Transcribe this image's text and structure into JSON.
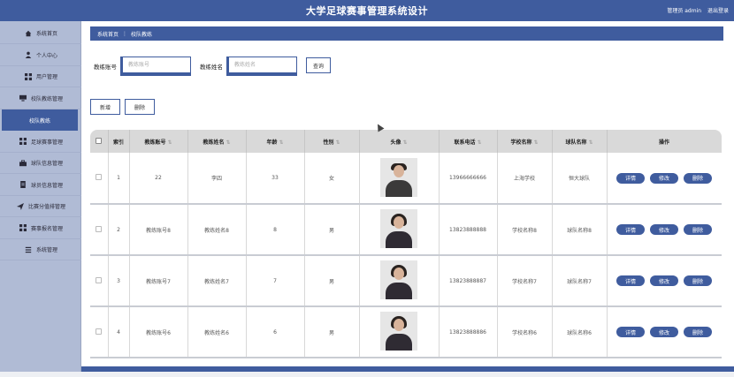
{
  "header": {
    "title": "大学足球赛事管理系统设计",
    "user_label": "管理员 admin",
    "logout_label": "退出登录"
  },
  "sidebar": {
    "items": [
      {
        "label": "系统首页",
        "icon": "home-icon"
      },
      {
        "label": "个人中心",
        "icon": "person-icon"
      },
      {
        "label": "用户管理",
        "icon": "grid-icon"
      },
      {
        "label": "校队教练管理",
        "icon": "screen-icon"
      },
      {
        "label": "校队教练",
        "icon": "",
        "active": true
      },
      {
        "label": "足球赛事管理",
        "icon": "grid-icon"
      },
      {
        "label": "球队信息管理",
        "icon": "briefcase-icon"
      },
      {
        "label": "球员信息管理",
        "icon": "document-icon"
      },
      {
        "label": "比赛分值排管理",
        "icon": "plane-icon"
      },
      {
        "label": "赛事报名管理",
        "icon": "grid-icon"
      },
      {
        "label": "系统管理",
        "icon": "settings-icon"
      }
    ]
  },
  "breadcrumb": {
    "home": "系统首页",
    "separator": "⋮",
    "current": "校队教练"
  },
  "search": {
    "account_label": "教练账号",
    "account_placeholder": "教练账号",
    "name_label": "教练姓名",
    "name_placeholder": "教练姓名",
    "query_label": "查询"
  },
  "actions": {
    "add_label": "新增",
    "delete_label": "删除"
  },
  "table": {
    "headers": [
      "索引",
      "教练账号",
      "教练姓名",
      "年龄",
      "性别",
      "头像",
      "联系电话",
      "学校名称",
      "球队名称",
      "操作"
    ],
    "rows": [
      {
        "index": "1",
        "account": "22",
        "name": "李四",
        "age": "33",
        "gender": "女",
        "phone": "13966666666",
        "school": "上海学校",
        "team": "恒大球队",
        "avatar": "male"
      },
      {
        "index": "2",
        "account": "教练账号8",
        "name": "教练姓名8",
        "age": "8",
        "gender": "男",
        "phone": "13823888888",
        "school": "学校名称8",
        "team": "球队名称8",
        "avatar": "female"
      },
      {
        "index": "3",
        "account": "教练账号7",
        "name": "教练姓名7",
        "age": "7",
        "gender": "男",
        "phone": "13823888887",
        "school": "学校名称7",
        "team": "球队名称7",
        "avatar": "female"
      },
      {
        "index": "4",
        "account": "教练账号6",
        "name": "教练姓名6",
        "age": "6",
        "gender": "男",
        "phone": "13823888886",
        "school": "学校名称6",
        "team": "球队名称6",
        "avatar": "female"
      }
    ],
    "ops": {
      "detail": "详情",
      "edit": "修改",
      "delete": "删除"
    }
  },
  "colors": {
    "primary": "#3f5c9e",
    "sidebar": "#b0bbd5",
    "header_row": "#d9d9d9"
  }
}
